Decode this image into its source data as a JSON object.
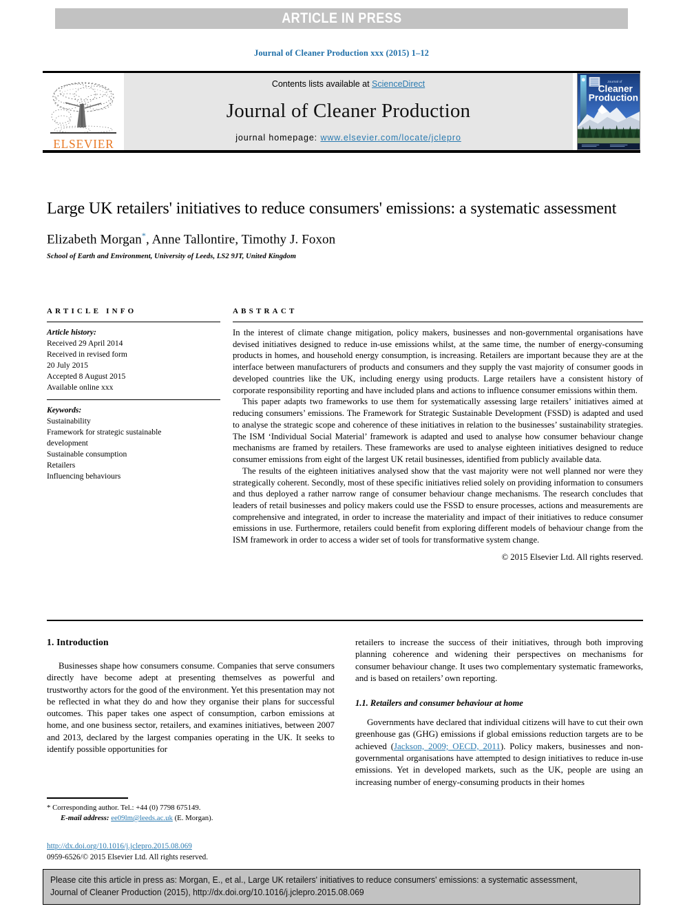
{
  "banner": {
    "label": "ARTICLE IN PRESS",
    "background": "#c2c2c2",
    "text_color": "#ffffff"
  },
  "running_head": "Journal of Cleaner Production xxx (2015) 1–12",
  "masthead": {
    "contents_prefix": "Contents lists available at ",
    "sciencedirect": "ScienceDirect",
    "journal_title": "Journal of Cleaner Production",
    "homepage_prefix": "journal homepage: ",
    "homepage_url": "www.elsevier.com/locate/jclepro",
    "publisher_wordmark": "ELSEVIER",
    "publisher_color": "#e87722",
    "link_color": "#2a7ab0",
    "cover": {
      "line1": "Journal of",
      "line2": "Cleaner",
      "line3": "Production"
    }
  },
  "article": {
    "title": "Large UK retailers' initiatives to reduce consumers' emissions: a systematic assessment",
    "authors": "Elizabeth Morgan",
    "corresponding_marker": "*",
    "authors_rest": ", Anne Tallontire, Timothy J. Foxon",
    "affiliation": "School of Earth and Environment, University of Leeds, LS2 9JT, United Kingdom"
  },
  "article_info": {
    "heading": "ARTICLE INFO",
    "history_label": "Article history:",
    "history": [
      "Received 29 April 2014",
      "Received in revised form",
      "20 July 2015",
      "Accepted 8 August 2015",
      "Available online xxx"
    ],
    "keywords_label": "Keywords:",
    "keywords": [
      "Sustainability",
      "Framework for strategic sustainable",
      "development",
      "Sustainable consumption",
      "Retailers",
      "Influencing behaviours"
    ]
  },
  "abstract": {
    "heading": "ABSTRACT",
    "paragraphs": [
      "In the interest of climate change mitigation, policy makers, businesses and non-governmental organisations have devised initiatives designed to reduce in-use emissions whilst, at the same time, the number of energy-consuming products in homes, and household energy consumption, is increasing. Retailers are important because they are at the interface between manufacturers of products and consumers and they supply the vast majority of consumer goods in developed countries like the UK, including energy using products. Large retailers have a consistent history of corporate responsibility reporting and have included plans and actions to influence consumer emissions within them.",
      "This paper adapts two frameworks to use them for systematically assessing large retailers’ initiatives aimed at reducing consumers’ emissions. The Framework for Strategic Sustainable Development (FSSD) is adapted and used to analyse the strategic scope and coherence of these initiatives in relation to the businesses’ sustainability strategies. The ISM ‘Individual Social Material’ framework is adapted and used to analyse how consumer behaviour change mechanisms are framed by retailers. These frameworks are used to analyse eighteen initiatives designed to reduce consumer emissions from eight of the largest UK retail businesses, identified from publicly available data.",
      "The results of the eighteen initiatives analysed show that the vast majority were not well planned nor were they strategically coherent. Secondly, most of these specific initiatives relied solely on providing information to consumers and thus deployed a rather narrow range of consumer behaviour change mechanisms. The research concludes that leaders of retail businesses and policy makers could use the FSSD to ensure processes, actions and measurements are comprehensive and integrated, in order to increase the materiality and impact of their initiatives to reduce consumer emissions in use. Furthermore, retailers could benefit from exploring different models of behaviour change from the ISM framework in order to access a wider set of tools for transformative system change."
    ],
    "copyright": "© 2015 Elsevier Ltd. All rights reserved."
  },
  "body": {
    "intro_heading": "1. Introduction",
    "intro_para_left": "Businesses shape how consumers consume. Companies that serve consumers directly have become adept at presenting themselves as powerful and trustworthy actors for the good of the environment. Yet this presentation may not be reflected in what they do and how they organise their plans for successful outcomes. This paper takes one aspect of consumption, carbon emissions at home, and one business sector, retailers, and examines initiatives, between 2007 and 2013, declared by the largest companies operating in the UK. It seeks to identify possible opportunities for",
    "intro_para_right_cont": "retailers to increase the success of their initiatives, through both improving planning coherence and widening their perspectives on mechanisms for consumer behaviour change. It uses two complementary systematic frameworks, and is based on retailers’ own reporting.",
    "subsection_heading": "1.1. Retailers and consumer behaviour at home",
    "sub_para_a": "Governments have declared that individual citizens will have to cut their own greenhouse gas (GHG) emissions if global emissions reduction targets are to be achieved (",
    "sub_para_citation": "Jackson, 2009; OECD, 2011",
    "sub_para_b": "). Policy makers, businesses and non-governmental organisations have attempted to design initiatives to reduce in-use emissions. Yet in developed markets, such as the UK, people are using an increasing number of energy-consuming products in their homes"
  },
  "footnote": {
    "corresponding": "* Corresponding author. Tel.: +44 (0) 7798 675149.",
    "email_label": "E-mail address:",
    "email": "ee09lm@leeds.ac.uk",
    "email_suffix": "(E. Morgan).",
    "doi_url": "http://dx.doi.org/10.1016/j.jclepro.2015.08.069",
    "issn_line": "0959-6526/© 2015 Elsevier Ltd. All rights reserved."
  },
  "cite_box": {
    "line1": "Please cite this article in press as: Morgan, E., et al., Large UK retailers' initiatives to reduce consumers' emissions: a systematic assessment,",
    "line2": "Journal of Cleaner Production (2015), http://dx.doi.org/10.1016/j.jclepro.2015.08.069"
  }
}
